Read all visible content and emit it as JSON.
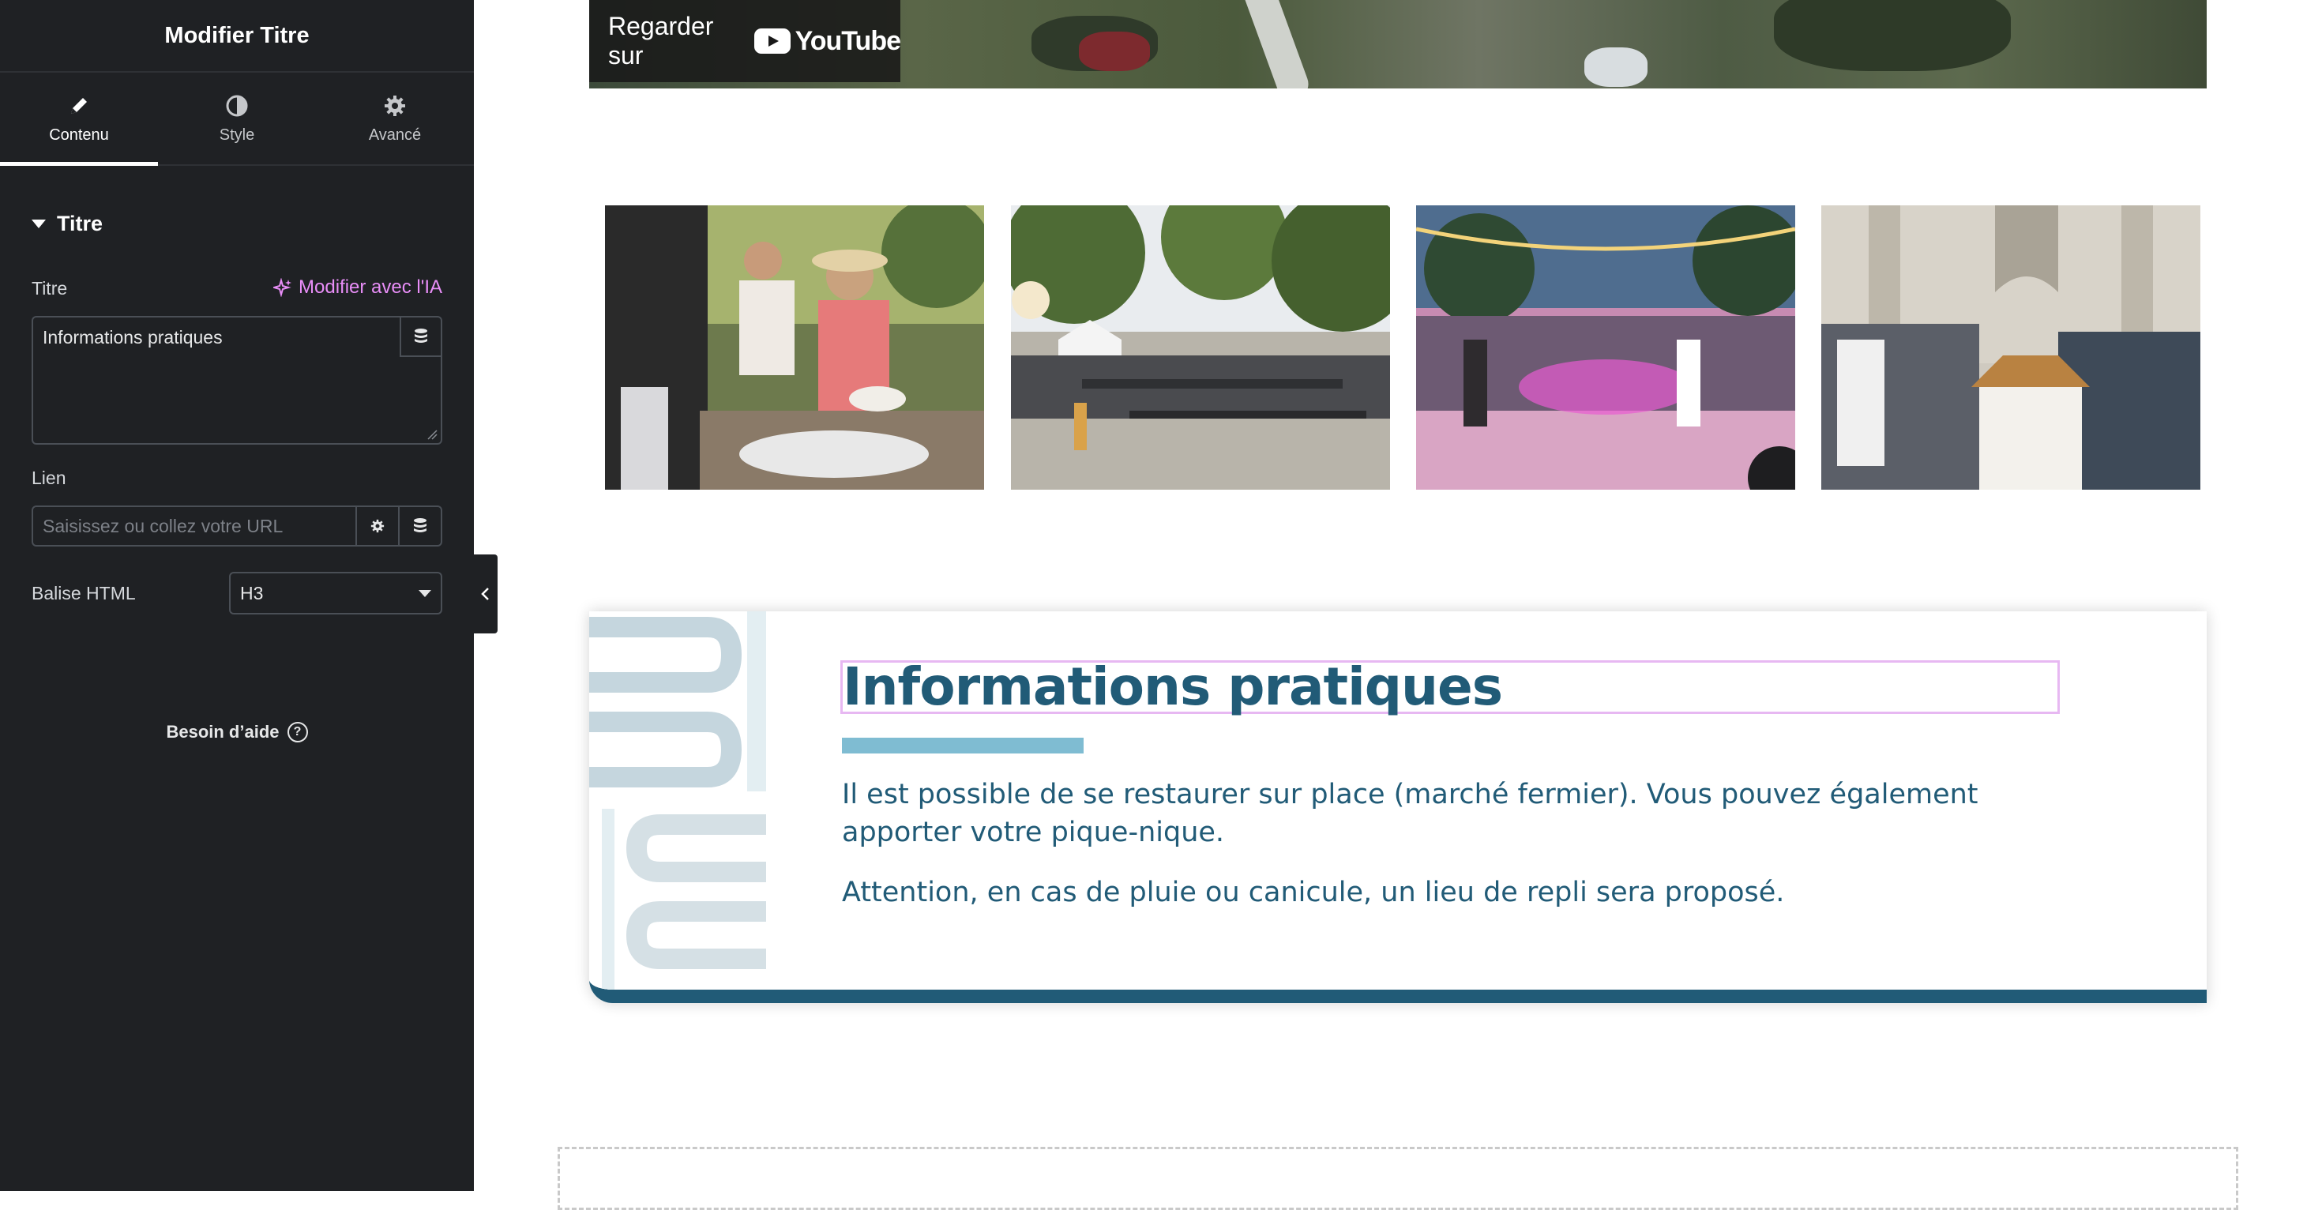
{
  "panel": {
    "title": "Modifier Titre",
    "tabs": [
      {
        "label": "Contenu",
        "icon": "pencil-icon",
        "active": true
      },
      {
        "label": "Style",
        "icon": "contrast-icon",
        "active": false
      },
      {
        "label": "Avancé",
        "icon": "gear-icon",
        "active": false
      }
    ],
    "section_title": "Titre",
    "title_field": {
      "label": "Titre",
      "ai_link": "Modifier avec l'IA",
      "value": "Informations pratiques"
    },
    "link_field": {
      "label": "Lien",
      "placeholder": "Saisissez ou collez votre URL"
    },
    "html_tag_field": {
      "label": "Balise HTML",
      "value": "H3"
    },
    "help": "Besoin d’aide",
    "accent_color": "#e98ef8"
  },
  "video": {
    "watch_label": "Regarder sur",
    "platform": "YouTube"
  },
  "gallery": [
    {
      "alt": "marché fermier photo",
      "icon": "photo-market"
    },
    {
      "alt": "repas en plein air photo",
      "icon": "photo-dining"
    },
    {
      "alt": "bal festif photo",
      "icon": "photo-dance"
    },
    {
      "alt": "visite église photo",
      "icon": "photo-church"
    }
  ],
  "info_card": {
    "heading": "Informations pratiques",
    "paragraphs": [
      "Il est possible de se restaurer sur place (marché fermier). Vous pouvez également apporter votre pique-nique.",
      "Attention, en cas de pluie ou canicule, un lieu de repli sera proposé."
    ],
    "heading_color": "#215b77",
    "bar_color": "#7fbcd2"
  }
}
